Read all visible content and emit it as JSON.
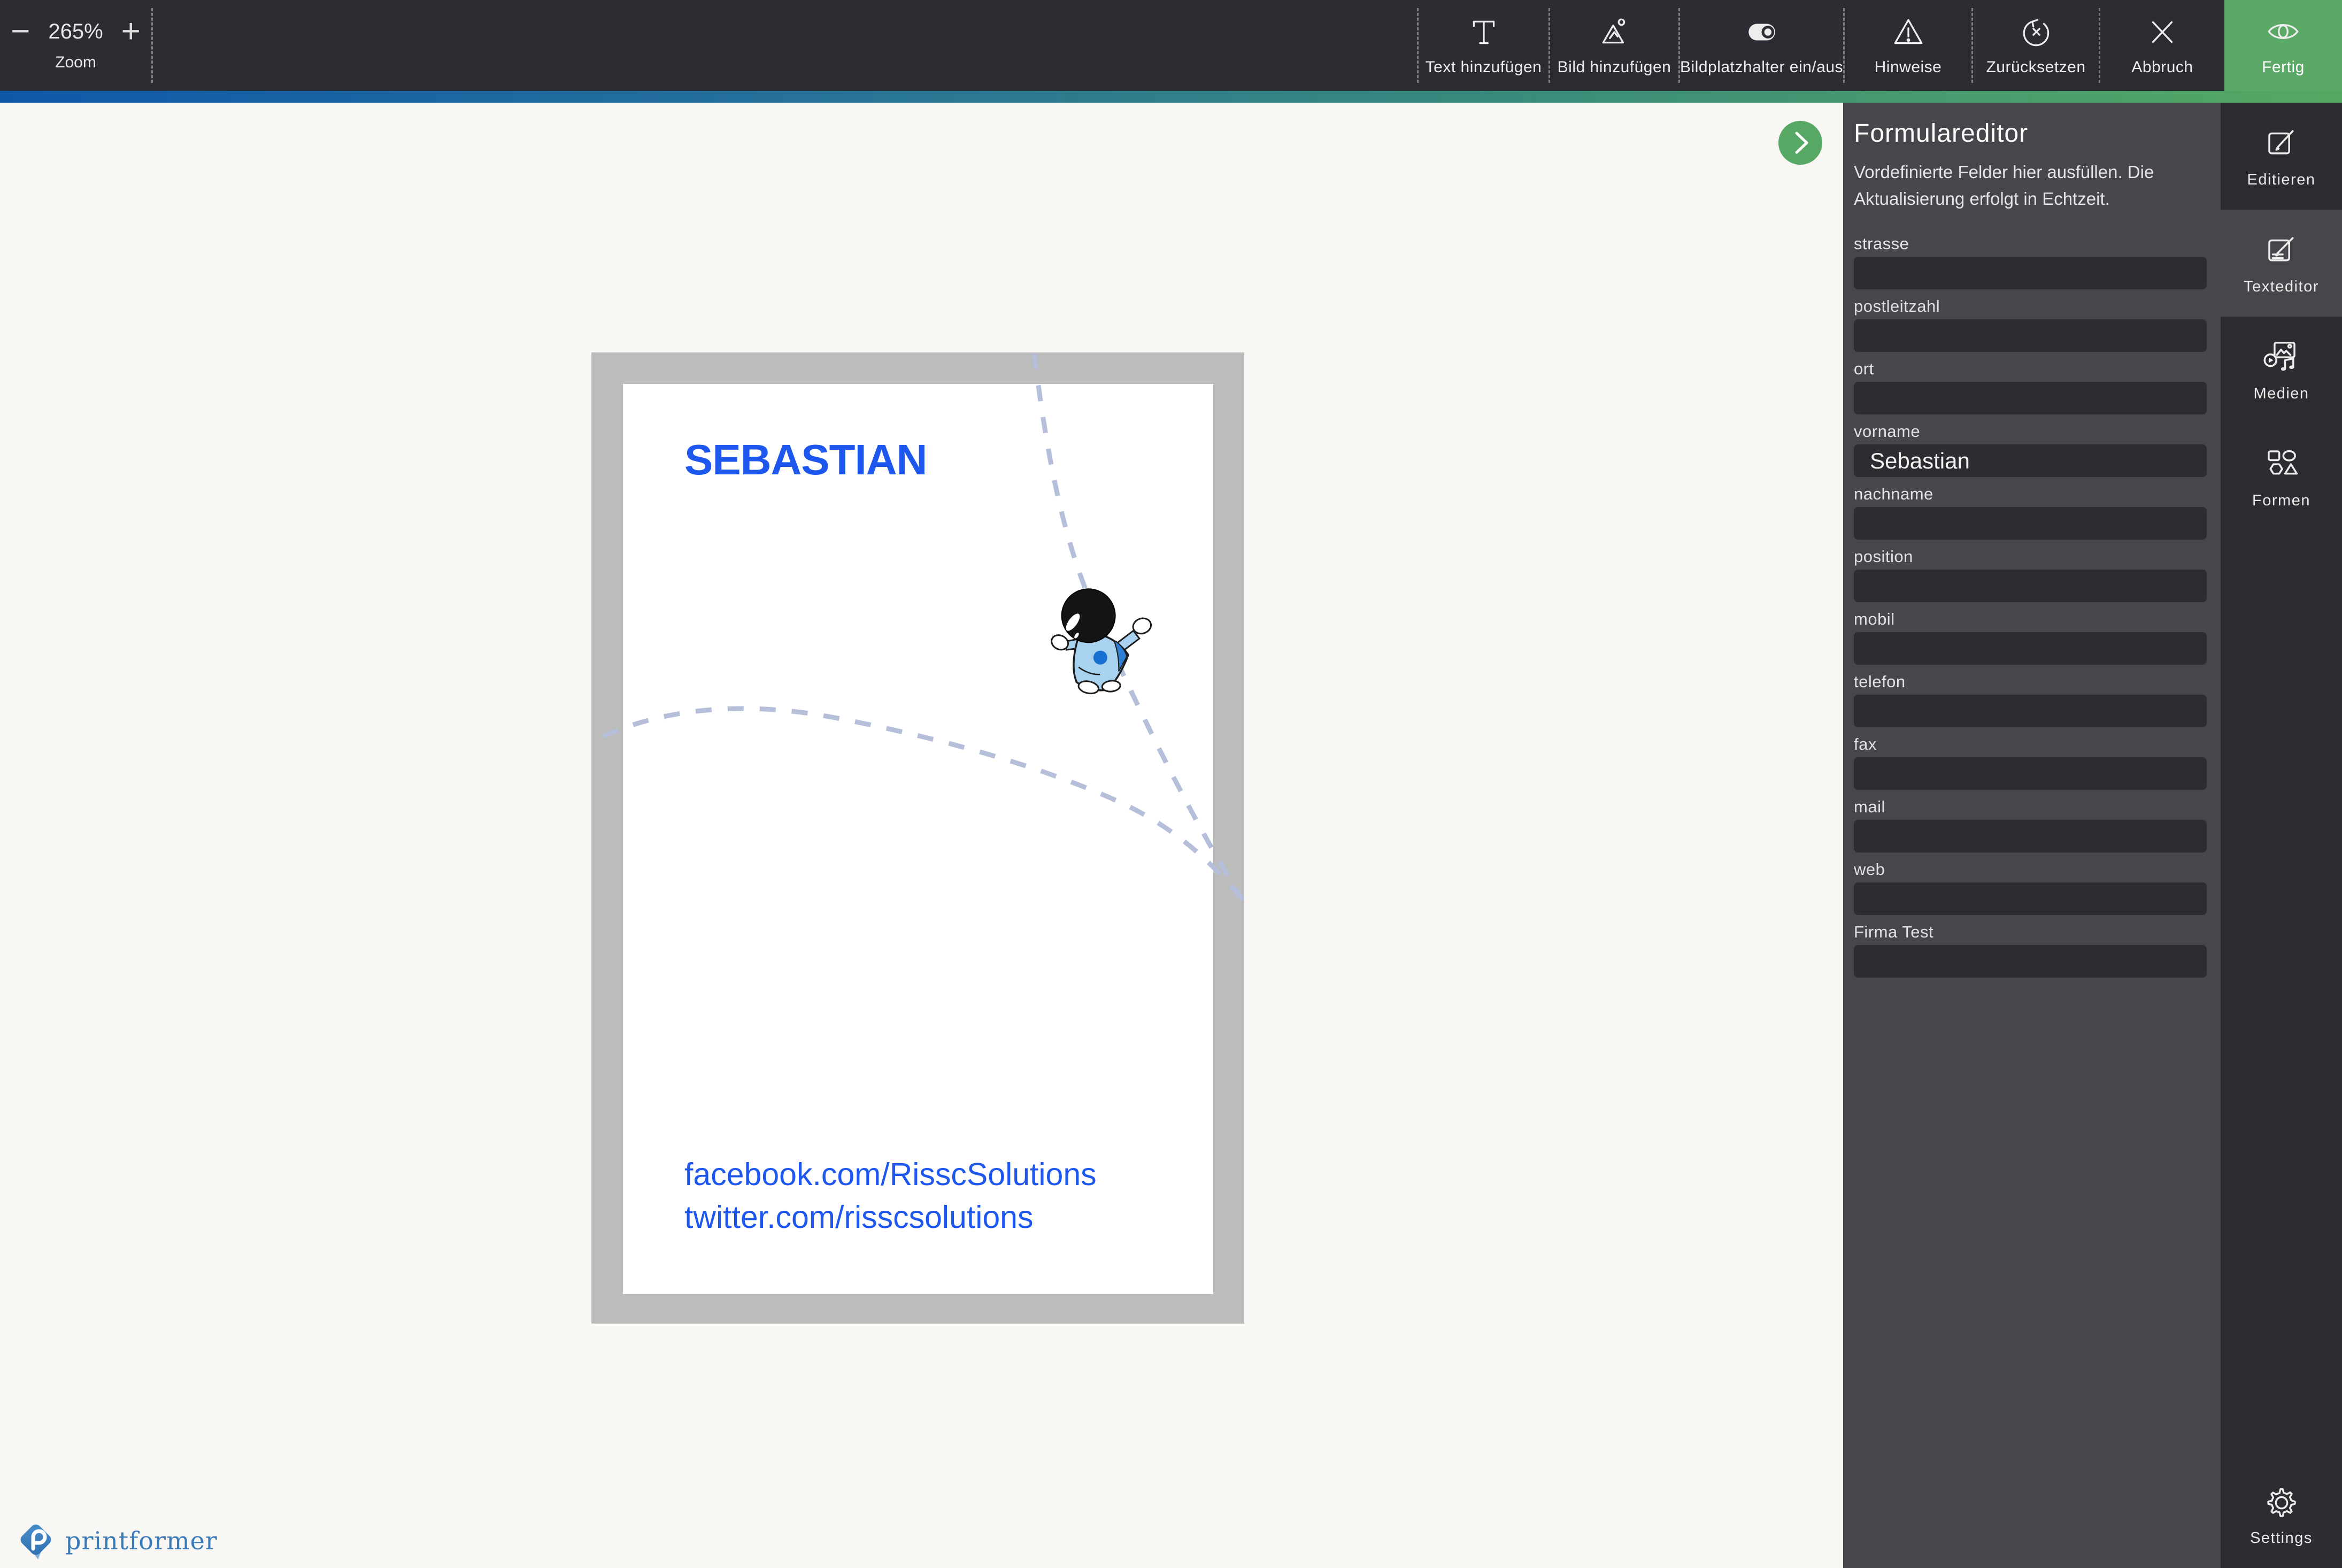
{
  "toolbar": {
    "zoom": {
      "minus": "−",
      "value": "265%",
      "plus": "+",
      "label": "Zoom"
    },
    "buttons": [
      {
        "label": "Text hinzufügen",
        "icon": "text-add-icon"
      },
      {
        "label": "Bild hinzufügen",
        "icon": "image-add-icon"
      },
      {
        "label": "Bildplatzhalter ein/aus",
        "icon": "toggle-icon"
      },
      {
        "label": "Hinweise",
        "icon": "warning-icon"
      },
      {
        "label": "Zurücksetzen",
        "icon": "reset-icon"
      },
      {
        "label": "Abbruch",
        "icon": "close-icon"
      },
      {
        "label": "Fertig",
        "icon": "eye-icon"
      }
    ]
  },
  "canvas": {
    "card": {
      "title": "SEBASTIAN",
      "links": [
        "facebook.com/RisscSolutions",
        "twitter.com/risscsolutions"
      ]
    }
  },
  "form_panel": {
    "title": "Formulareditor",
    "subtitle_lines": [
      "Vordefinierte Felder hier ausfüllen. Die",
      "Aktualisierung erfolgt in Echtzeit."
    ],
    "fields": [
      {
        "label": "strasse",
        "value": ""
      },
      {
        "label": "postleitzahl",
        "value": ""
      },
      {
        "label": "ort",
        "value": ""
      },
      {
        "label": "vorname",
        "value": "Sebastian"
      },
      {
        "label": "nachname",
        "value": ""
      },
      {
        "label": "position",
        "value": ""
      },
      {
        "label": "mobil",
        "value": ""
      },
      {
        "label": "telefon",
        "value": ""
      },
      {
        "label": "fax",
        "value": ""
      },
      {
        "label": "mail",
        "value": ""
      },
      {
        "label": "web",
        "value": ""
      },
      {
        "label": "Firma Test",
        "value": ""
      }
    ]
  },
  "sidebar": {
    "items": [
      {
        "label": "Editieren",
        "active": false
      },
      {
        "label": "Texteditor",
        "active": true
      },
      {
        "label": "Medien",
        "active": false
      },
      {
        "label": "Formen",
        "active": false
      }
    ],
    "settings_label": "Settings"
  },
  "footer": {
    "brand": "printformer"
  },
  "colors": {
    "toolbar_bg": "#2b2d32",
    "panel_bg": "#46474b",
    "input_bg": "#2b2d30",
    "rail_bg": "#2b2d31",
    "accent_green": "#5aa967",
    "gradient_left": "#0f58a9",
    "gradient_right": "#55a862",
    "link_blue": "#1d57ee",
    "mat_gray": "#bcbcbc",
    "canvas_bg": "#f8f7f4",
    "brand_blue": "#3a7ab8"
  }
}
